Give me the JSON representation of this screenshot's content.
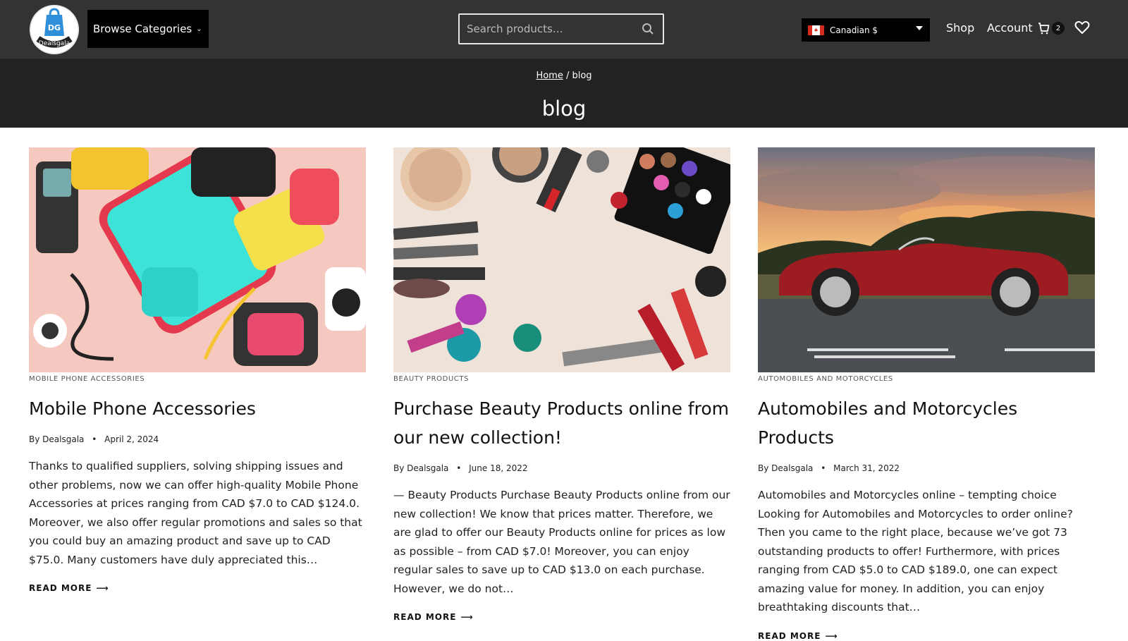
{
  "header": {
    "logo_text": "DG Dealsgala",
    "browse_label": "Browse Categories",
    "search_placeholder": "Search products…",
    "currency_label": "Canadian $",
    "nav": {
      "shop": "Shop",
      "account": "Account"
    },
    "cart_count": "2",
    "bg_color": "#333333"
  },
  "titlebar": {
    "breadcrumb_home": "Home",
    "breadcrumb_sep": " / ",
    "breadcrumb_current": "blog",
    "page_title": "blog"
  },
  "posts": [
    {
      "category": "MOBILE PHONE ACCESSORIES",
      "title": "Mobile Phone Accessories",
      "author_prefix": "By",
      "author": "Dealsgala",
      "date": "April 2, 2024",
      "excerpt": "Thanks to qualified suppliers, solving shipping issues and other problems, now we can offer high-quality Mobile Phone Accessories at prices ranging from CAD $7.0 to CAD $124.0. Moreover, we also offer regular promotions and sales so that you could buy an amazing product and save up to CAD $75.0. Many customers have duly appreciated this…",
      "read_more": "READ MORE",
      "image_icon": "phone-accessories-image"
    },
    {
      "category": "BEAUTY PRODUCTS",
      "title": "Purchase Beauty Products online from our new collection!",
      "author_prefix": "By",
      "author": "Dealsgala",
      "date": "June 18, 2022",
      "excerpt": "— Beauty Products Purchase Beauty Products online from our new collection! We know that prices matter. Therefore, we are glad to offer our Beauty Products online for prices as low as possible – from CAD $7.0! Moreover, you can enjoy regular sales to save up to CAD $13.0 on each purchase. However, we do not…",
      "read_more": "READ MORE",
      "image_icon": "makeup-image"
    },
    {
      "category": "AUTOMOBILES AND MOTORCYCLES",
      "title": "Automobiles and Motorcycles Products",
      "author_prefix": "By",
      "author": "Dealsgala",
      "date": "March 31, 2022",
      "excerpt": "Automobiles and Motorcycles online – tempting choice Looking for Automobiles and Motorcycles to order online? Then you came to the right place, because we’ve got 73 outstanding products to offer! Furthermore, with prices ranging from CAD $5.0 to CAD $189.0, one can expect amazing value for money. In addition, you can enjoy breathtaking discounts that…",
      "read_more": "READ MORE",
      "image_icon": "red-car-image"
    }
  ]
}
